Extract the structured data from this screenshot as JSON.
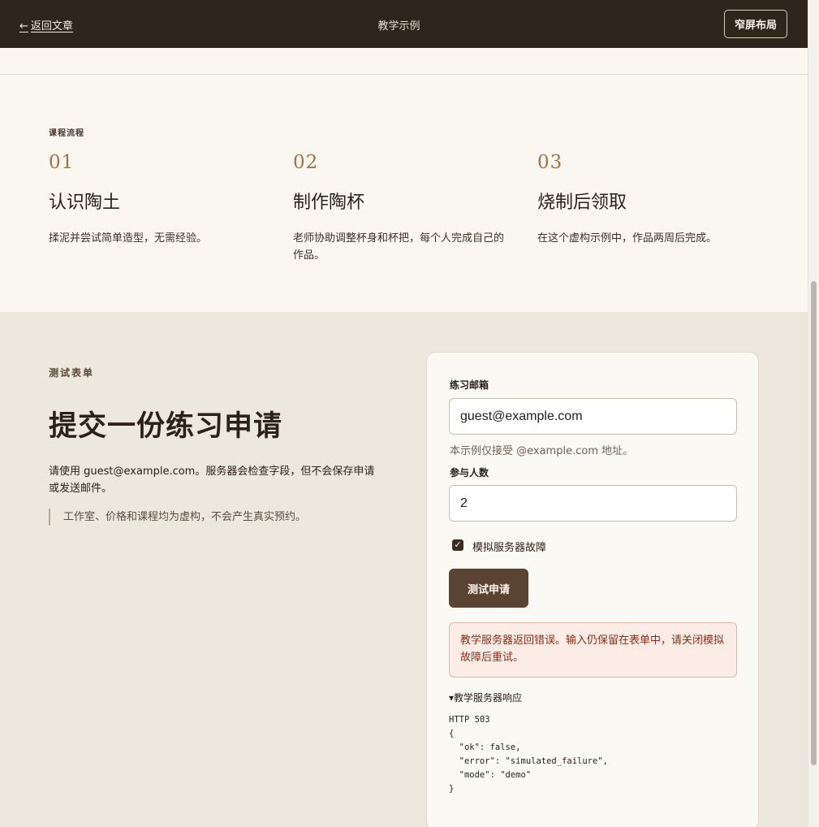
{
  "topbar": {
    "back_arrow": "←",
    "back_label": "返回文章",
    "title": "教学示例",
    "narrow_layout_label": "窄屏布局"
  },
  "process": {
    "eyebrow": "课程流程",
    "steps": [
      {
        "number": "01",
        "title": "认识陶土",
        "desc": "揉泥并尝试简单造型，无需经验。"
      },
      {
        "number": "02",
        "title": "制作陶杯",
        "desc": "老师协助调整杯身和杯把，每个人完成自己的作品。"
      },
      {
        "number": "03",
        "title": "烧制后领取",
        "desc": "在这个虚构示例中，作品两周后完成。"
      }
    ]
  },
  "form_section": {
    "eyebrow": "测试表单",
    "title": "提交一份练习申请",
    "intro": "请使用 guest@example.com。服务器会检查字段，但不会保存申请或发送邮件。",
    "note": "工作室、价格和课程均为虚构，不会产生真实预约。"
  },
  "form": {
    "email_label": "练习邮箱",
    "email_value": "guest@example.com",
    "email_hint": "本示例仅接受 @example.com 地址。",
    "count_label": "参与人数",
    "count_value": "2",
    "simulate_failure_label": "模拟服务器故障",
    "simulate_failure_checked": true,
    "submit_label": "测试申请",
    "error_message": "教学服务器返回错误。输入仍保留在表单中，请关闭模拟故障后重试。",
    "response_summary": "▾教学服务器响应",
    "response_body": "HTTP 503\n{\n  \"ok\": false,\n  \"error\": \"simulated_failure\",\n  \"mode\": \"demo\"\n}"
  },
  "colors": {
    "topbar_bg": "#2f251d",
    "page_bg": "#ede8dd",
    "process_bg": "#faf7f0",
    "accent_number": "#9a7550",
    "button_bg": "#5a4333",
    "error_bg": "#fbece6",
    "error_text": "#8c2f1b"
  }
}
